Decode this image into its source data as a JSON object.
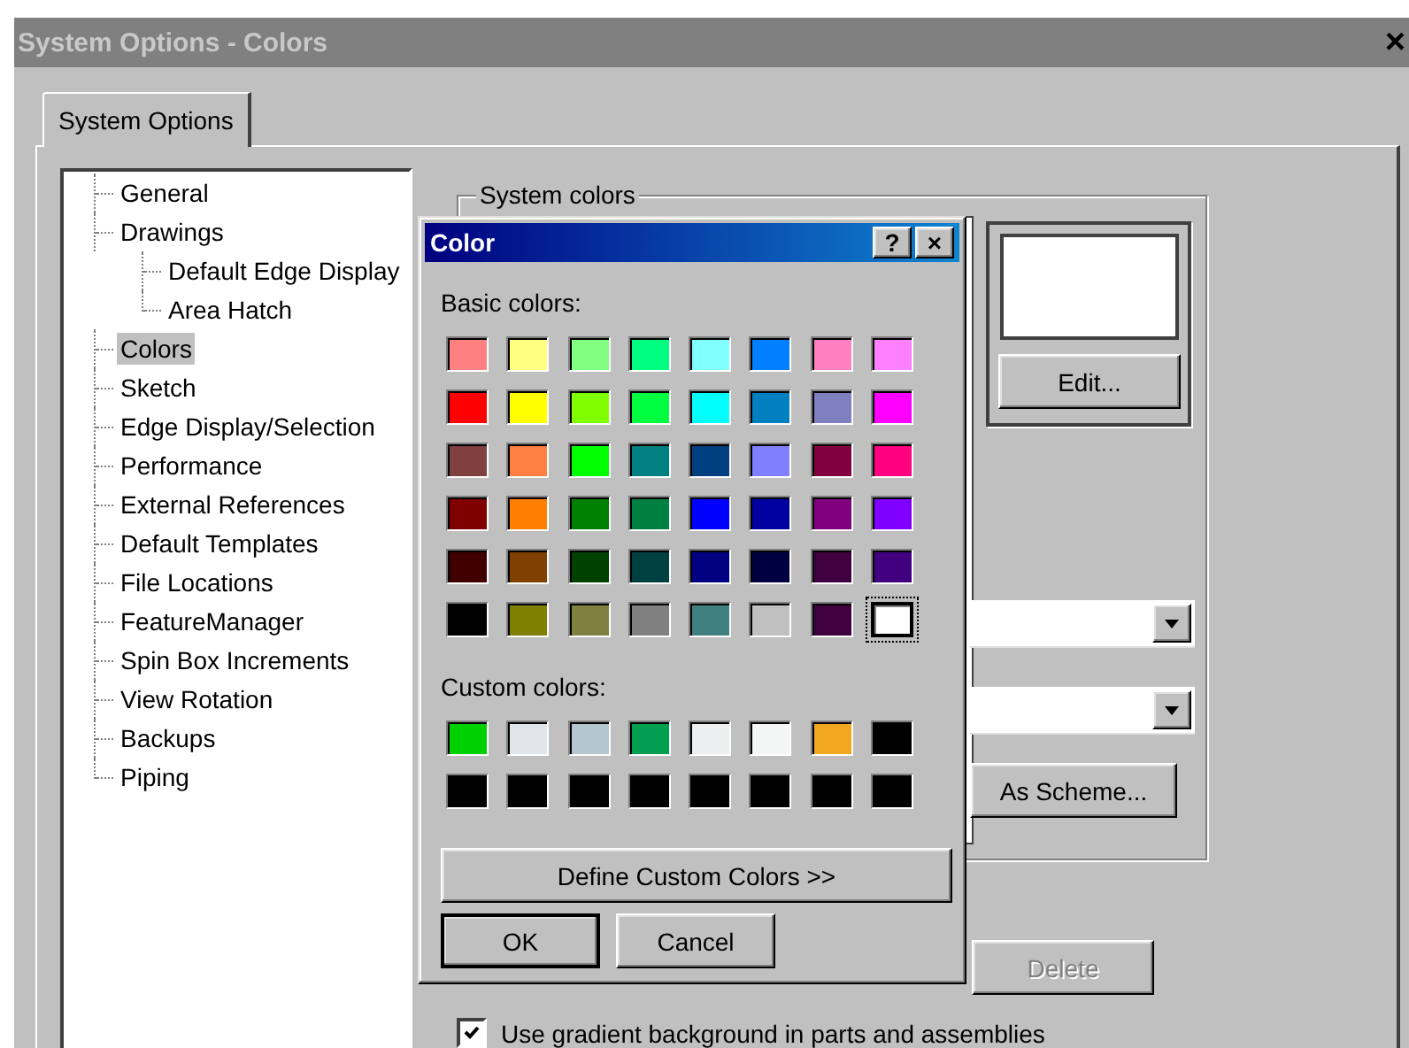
{
  "window": {
    "title": "System Options - Colors",
    "close": "×"
  },
  "tabs": [
    {
      "label": "System Options",
      "selected": true
    }
  ],
  "tree": [
    {
      "label": "General",
      "selected": false
    },
    {
      "label": "Drawings",
      "selected": false,
      "children": [
        {
          "label": "Default Edge Display",
          "selected": false
        },
        {
          "label": "Area Hatch",
          "selected": false
        }
      ]
    },
    {
      "label": "Colors",
      "selected": true
    },
    {
      "label": "Sketch",
      "selected": false
    },
    {
      "label": "Edge Display/Selection",
      "selected": false
    },
    {
      "label": "Performance",
      "selected": false
    },
    {
      "label": "External References",
      "selected": false
    },
    {
      "label": "Default Templates",
      "selected": false
    },
    {
      "label": "File Locations",
      "selected": false
    },
    {
      "label": "FeatureManager",
      "selected": false
    },
    {
      "label": "Spin Box Increments",
      "selected": false
    },
    {
      "label": "View Rotation",
      "selected": false
    },
    {
      "label": "Backups",
      "selected": false
    },
    {
      "label": "Piping",
      "selected": false
    }
  ],
  "system_colors": {
    "label": "System colors",
    "edit_button": "Edit...",
    "scheme_button": "As Scheme..."
  },
  "delete_button": {
    "label": "Delete",
    "disabled": true
  },
  "gradient_checkbox": {
    "label": "Use gradient background in parts and assemblies",
    "checked": true
  },
  "color_dialog": {
    "title": "Color",
    "help_button": "?",
    "close_button": "×",
    "basic_label": "Basic colors:",
    "basic_colors": [
      {
        "color": "#ff8080",
        "selected": false
      },
      {
        "color": "#ffff80",
        "selected": false
      },
      {
        "color": "#80ff80",
        "selected": false
      },
      {
        "color": "#00ff80",
        "selected": false
      },
      {
        "color": "#80ffff",
        "selected": false
      },
      {
        "color": "#0080ff",
        "selected": false
      },
      {
        "color": "#ff80c0",
        "selected": false
      },
      {
        "color": "#ff80ff",
        "selected": false
      },
      {
        "color": "#ff0000",
        "selected": false
      },
      {
        "color": "#ffff00",
        "selected": false
      },
      {
        "color": "#80ff00",
        "selected": false
      },
      {
        "color": "#00ff40",
        "selected": false
      },
      {
        "color": "#00ffff",
        "selected": false
      },
      {
        "color": "#0080c0",
        "selected": false
      },
      {
        "color": "#8080c0",
        "selected": false
      },
      {
        "color": "#ff00ff",
        "selected": false
      },
      {
        "color": "#804040",
        "selected": false
      },
      {
        "color": "#ff8040",
        "selected": false
      },
      {
        "color": "#00ff00",
        "selected": false
      },
      {
        "color": "#008080",
        "selected": false
      },
      {
        "color": "#004080",
        "selected": false
      },
      {
        "color": "#8080ff",
        "selected": false
      },
      {
        "color": "#800040",
        "selected": false
      },
      {
        "color": "#ff0080",
        "selected": false
      },
      {
        "color": "#800000",
        "selected": false
      },
      {
        "color": "#ff8000",
        "selected": false
      },
      {
        "color": "#008000",
        "selected": false
      },
      {
        "color": "#008040",
        "selected": false
      },
      {
        "color": "#0000ff",
        "selected": false
      },
      {
        "color": "#0000a0",
        "selected": false
      },
      {
        "color": "#800080",
        "selected": false
      },
      {
        "color": "#8000ff",
        "selected": false
      },
      {
        "color": "#400000",
        "selected": false
      },
      {
        "color": "#804000",
        "selected": false
      },
      {
        "color": "#004000",
        "selected": false
      },
      {
        "color": "#004040",
        "selected": false
      },
      {
        "color": "#000080",
        "selected": false
      },
      {
        "color": "#000040",
        "selected": false
      },
      {
        "color": "#400040",
        "selected": false
      },
      {
        "color": "#400080",
        "selected": false
      },
      {
        "color": "#000000",
        "selected": false
      },
      {
        "color": "#808000",
        "selected": false
      },
      {
        "color": "#808040",
        "selected": false
      },
      {
        "color": "#808080",
        "selected": false
      },
      {
        "color": "#408080",
        "selected": false
      },
      {
        "color": "#c0c0c0",
        "selected": false
      },
      {
        "color": "#400040",
        "selected": false
      },
      {
        "color": "#ffffff",
        "selected": true
      }
    ],
    "custom_label": "Custom colors:",
    "custom_colors": [
      {
        "color": "#00d000",
        "selected": false
      },
      {
        "color": "#e0e6ea",
        "selected": false
      },
      {
        "color": "#b4c6d0",
        "selected": false
      },
      {
        "color": "#00a050",
        "selected": false
      },
      {
        "color": "#eceef0",
        "selected": false
      },
      {
        "color": "#f4f6f6",
        "selected": false
      },
      {
        "color": "#f0a820",
        "selected": false
      },
      {
        "color": "#000000",
        "selected": false
      },
      {
        "color": "#000000",
        "selected": false
      },
      {
        "color": "#000000",
        "selected": false
      },
      {
        "color": "#000000",
        "selected": false
      },
      {
        "color": "#000000",
        "selected": false
      },
      {
        "color": "#000000",
        "selected": false
      },
      {
        "color": "#000000",
        "selected": false
      },
      {
        "color": "#000000",
        "selected": false
      },
      {
        "color": "#000000",
        "selected": false
      }
    ],
    "define_button": "Define Custom Colors >>",
    "ok_button": "OK",
    "cancel_button": "Cancel"
  }
}
